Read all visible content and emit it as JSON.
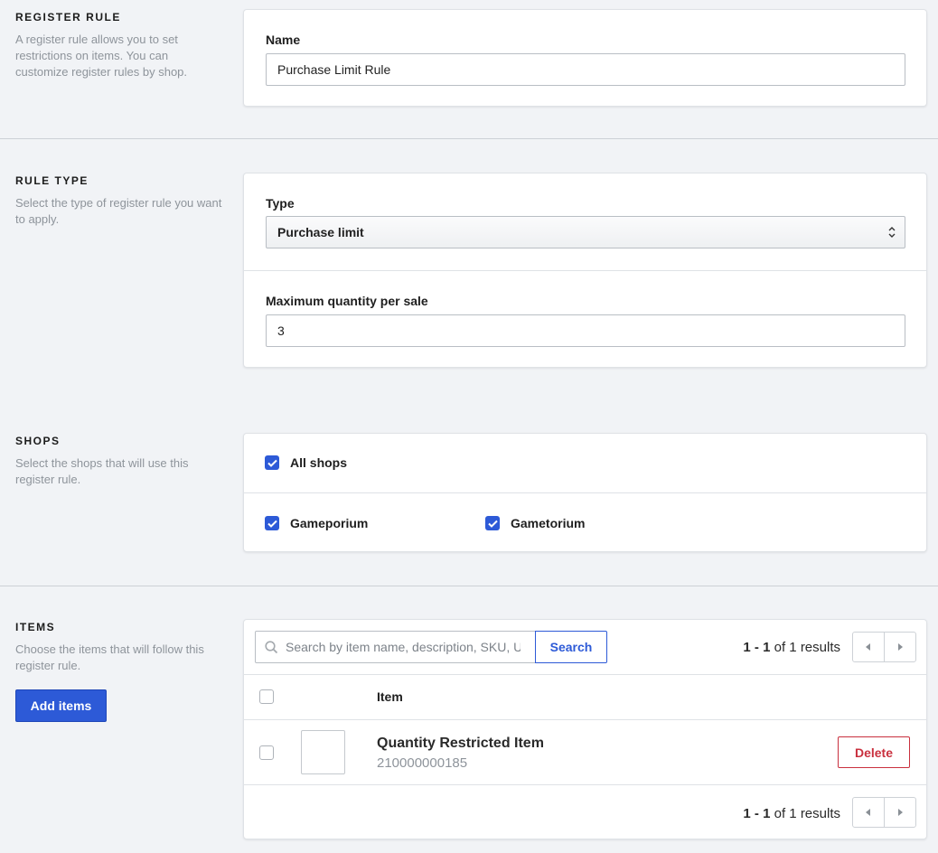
{
  "register_rule": {
    "title": "REGISTER RULE",
    "description": "A register rule allows you to set restrictions on items. You can customize register rules by shop.",
    "name_label": "Name",
    "name_value": "Purchase Limit Rule"
  },
  "rule_type": {
    "title": "RULE TYPE",
    "description": "Select the type of register rule you want to apply.",
    "type_label": "Type",
    "type_value": "Purchase limit",
    "max_label": "Maximum quantity per sale",
    "max_value": "3"
  },
  "shops": {
    "title": "SHOPS",
    "description": "Select the shops that will use this register rule.",
    "all_label": "All shops",
    "items": [
      {
        "label": "Gameporium",
        "checked": true
      },
      {
        "label": "Gametorium",
        "checked": true
      }
    ]
  },
  "items": {
    "title": "ITEMS",
    "description": "Choose the items that will follow this register rule.",
    "add_button": "Add items",
    "search_placeholder": "Search by item name, description, SKU, U",
    "search_button": "Search",
    "results": {
      "range": "1 - 1",
      "of_word": "of",
      "total": "1",
      "suffix": "results"
    },
    "column_item": "Item",
    "rows": [
      {
        "name": "Quantity Restricted Item",
        "sku": "210000000185",
        "delete_label": "Delete"
      }
    ]
  },
  "colors": {
    "accent": "#2d5ad7",
    "danger": "#c9303e",
    "background": "#f1f3f6"
  }
}
